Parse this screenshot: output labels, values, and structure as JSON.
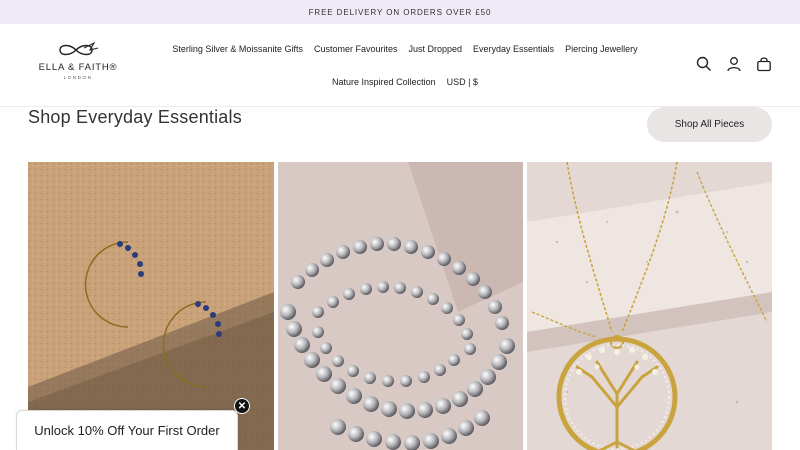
{
  "announcement": {
    "text": "FREE DELIVERY ON ORDERS OVER £50"
  },
  "logo": {
    "brand": "ELLA & FAITH®",
    "city": "LONDON"
  },
  "nav": {
    "row1": [
      {
        "label": "Sterling Silver & Moissanite Gifts"
      },
      {
        "label": "Customer Favourites"
      },
      {
        "label": "Just Dropped"
      },
      {
        "label": "Everyday Essentials"
      },
      {
        "label": "Piercing Jewellery"
      }
    ],
    "row2": [
      {
        "label": "Nature Inspired Collection"
      },
      {
        "label": "USD | $"
      }
    ]
  },
  "header_icons": [
    "search-icon",
    "account-icon",
    "bag-icon"
  ],
  "section": {
    "title": "Shop Everyday Essentials",
    "cta_label": "Shop All Pieces"
  },
  "products": [
    {
      "image": "gold crescent moon stud earrings with blue stones"
    },
    {
      "image": "silver ball bead bracelets"
    },
    {
      "image": "gold tree of life pendant necklace"
    }
  ],
  "promo": {
    "label": "Unlock 10% Off Your First Order",
    "close_symbol": "✕"
  },
  "colors": {
    "announcement_bg": "#efeaf6",
    "button_bg": "#e9e5e4",
    "text": "#222222"
  }
}
